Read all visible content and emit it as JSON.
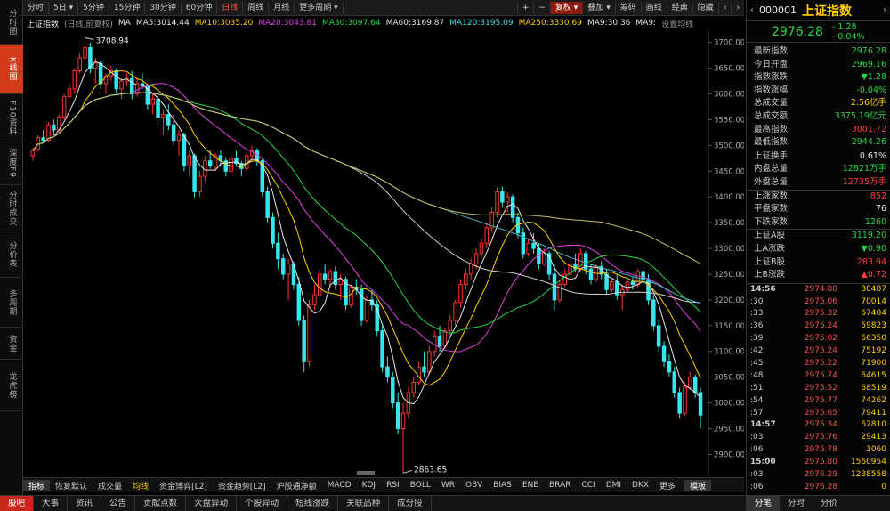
{
  "left_tabs": [
    "分时图",
    "K线图",
    "F10资料",
    "深度F9",
    "分时成交",
    "分价表",
    "多周期",
    "资金",
    "龙虎榜"
  ],
  "period_buttons": [
    "分时",
    "5日",
    "5分钟",
    "15分钟",
    "30分钟",
    "60分钟",
    "日线",
    "周线",
    "月线",
    "更多周期"
  ],
  "toolbar_right": {
    "plus": "+",
    "minus": "−",
    "fuquan": "复权",
    "overlay": "叠加",
    "chip": "筹码",
    "draw": "画线",
    "classic": "经典",
    "hide": "隐藏"
  },
  "ma_bar": {
    "name": "上证指数",
    "mode": "(日线,前复权)",
    "ma": "MA",
    "ma5": "MA5:3014.44",
    "ma10": "MA10:3035.20",
    "ma20": "MA20:3043.81",
    "ma30": "MA30:3097.64",
    "ma60": "MA60:3169.87",
    "ma120": "MA120:3195.09",
    "ma250": "MA250:3330.69",
    "ma9": "MA9:30.36",
    "ma9b": "MA9:",
    "set": "设置均线"
  },
  "chart_data": {
    "type": "candlestick",
    "y_ticks": [
      "3700.00",
      "3650.00",
      "3600.00",
      "3550.00",
      "3500.00",
      "3450.00",
      "3400.00",
      "3350.00",
      "3300.00",
      "3250.00",
      "3200.00",
      "3150.00",
      "3100.00",
      "3050.00",
      "3000.00",
      "2950.00",
      "2900.00"
    ],
    "ylim": [
      2880,
      3715
    ],
    "high_label": "3708.94",
    "low_label": "2863.65",
    "ohlc": [
      [
        3480,
        3495,
        3470,
        3490
      ],
      [
        3492,
        3520,
        3488,
        3515
      ],
      [
        3515,
        3530,
        3505,
        3510
      ],
      [
        3510,
        3545,
        3508,
        3540
      ],
      [
        3540,
        3550,
        3520,
        3530
      ],
      [
        3530,
        3560,
        3525,
        3555
      ],
      [
        3555,
        3600,
        3550,
        3595
      ],
      [
        3595,
        3620,
        3590,
        3610
      ],
      [
        3610,
        3650,
        3600,
        3645
      ],
      [
        3645,
        3680,
        3640,
        3670
      ],
      [
        3670,
        3708.94,
        3660,
        3690
      ],
      [
        3690,
        3700,
        3640,
        3650
      ],
      [
        3650,
        3670,
        3620,
        3660
      ],
      [
        3660,
        3665,
        3610,
        3620
      ],
      [
        3620,
        3640,
        3600,
        3635
      ],
      [
        3635,
        3655,
        3625,
        3645
      ],
      [
        3645,
        3650,
        3600,
        3610
      ],
      [
        3610,
        3630,
        3590,
        3625
      ],
      [
        3625,
        3640,
        3615,
        3630
      ],
      [
        3630,
        3645,
        3590,
        3600
      ],
      [
        3600,
        3630,
        3595,
        3620
      ],
      [
        3620,
        3640,
        3610,
        3615
      ],
      [
        3615,
        3620,
        3570,
        3580
      ],
      [
        3580,
        3600,
        3560,
        3590
      ],
      [
        3590,
        3595,
        3540,
        3555
      ],
      [
        3555,
        3570,
        3520,
        3560
      ],
      [
        3560,
        3580,
        3530,
        3540
      ],
      [
        3540,
        3560,
        3500,
        3510
      ],
      [
        3510,
        3530,
        3480,
        3520
      ],
      [
        3520,
        3525,
        3450,
        3460
      ],
      [
        3460,
        3490,
        3440,
        3480
      ],
      [
        3480,
        3485,
        3400,
        3410
      ],
      [
        3410,
        3450,
        3400,
        3440
      ],
      [
        3440,
        3480,
        3430,
        3470
      ],
      [
        3470,
        3490,
        3455,
        3460
      ],
      [
        3460,
        3485,
        3450,
        3480
      ],
      [
        3480,
        3490,
        3460,
        3470
      ],
      [
        3470,
        3475,
        3440,
        3450
      ],
      [
        3450,
        3480,
        3445,
        3475
      ],
      [
        3475,
        3490,
        3460,
        3465
      ],
      [
        3465,
        3470,
        3440,
        3455
      ],
      [
        3455,
        3485,
        3450,
        3480
      ],
      [
        3480,
        3500,
        3470,
        3490
      ],
      [
        3490,
        3495,
        3460,
        3470
      ],
      [
        3470,
        3475,
        3400,
        3410
      ],
      [
        3410,
        3420,
        3350,
        3360
      ],
      [
        3360,
        3370,
        3300,
        3310
      ],
      [
        3310,
        3330,
        3260,
        3280
      ],
      [
        3280,
        3290,
        3240,
        3250
      ],
      [
        3250,
        3280,
        3200,
        3270
      ],
      [
        3270,
        3275,
        3220,
        3230
      ],
      [
        3230,
        3245,
        3150,
        3160
      ],
      [
        3160,
        3170,
        3060,
        3080
      ],
      [
        3080,
        3200,
        3070,
        3190
      ],
      [
        3190,
        3230,
        3180,
        3210
      ],
      [
        3210,
        3260,
        3205,
        3250
      ],
      [
        3250,
        3270,
        3230,
        3240
      ],
      [
        3240,
        3260,
        3225,
        3255
      ],
      [
        3255,
        3265,
        3220,
        3230
      ],
      [
        3230,
        3250,
        3200,
        3240
      ],
      [
        3240,
        3245,
        3180,
        3190
      ],
      [
        3190,
        3230,
        3185,
        3225
      ],
      [
        3225,
        3240,
        3210,
        3220
      ],
      [
        3220,
        3230,
        3150,
        3160
      ],
      [
        3160,
        3210,
        3155,
        3200
      ],
      [
        3200,
        3220,
        3180,
        3190
      ],
      [
        3190,
        3200,
        3130,
        3140
      ],
      [
        3140,
        3150,
        3060,
        3070
      ],
      [
        3070,
        3090,
        3040,
        3050
      ],
      [
        3050,
        3060,
        2990,
        3000
      ],
      [
        3000,
        3020,
        2940,
        2950
      ],
      [
        2950,
        3000,
        2863.65,
        2980
      ],
      [
        2980,
        3030,
        2970,
        3020
      ],
      [
        3020,
        3050,
        3010,
        3040
      ],
      [
        3040,
        3080,
        3035,
        3070
      ],
      [
        3070,
        3100,
        3050,
        3060
      ],
      [
        3060,
        3110,
        3055,
        3100
      ],
      [
        3100,
        3140,
        3090,
        3130
      ],
      [
        3130,
        3150,
        3100,
        3110
      ],
      [
        3110,
        3145,
        3105,
        3140
      ],
      [
        3140,
        3170,
        3130,
        3160
      ],
      [
        3160,
        3200,
        3150,
        3195
      ],
      [
        3195,
        3240,
        3185,
        3230
      ],
      [
        3230,
        3260,
        3220,
        3250
      ],
      [
        3250,
        3280,
        3240,
        3270
      ],
      [
        3270,
        3300,
        3260,
        3290
      ],
      [
        3290,
        3320,
        3280,
        3310
      ],
      [
        3310,
        3350,
        3300,
        3340
      ],
      [
        3340,
        3380,
        3330,
        3370
      ],
      [
        3370,
        3420,
        3360,
        3410
      ],
      [
        3410,
        3420,
        3380,
        3390
      ],
      [
        3390,
        3410,
        3370,
        3400
      ],
      [
        3400,
        3405,
        3350,
        3360
      ],
      [
        3360,
        3370,
        3320,
        3330
      ],
      [
        3330,
        3340,
        3280,
        3290
      ],
      [
        3290,
        3320,
        3285,
        3310
      ],
      [
        3310,
        3330,
        3290,
        3300
      ],
      [
        3300,
        3310,
        3260,
        3270
      ],
      [
        3270,
        3300,
        3265,
        3290
      ],
      [
        3290,
        3295,
        3240,
        3250
      ],
      [
        3250,
        3270,
        3180,
        3200
      ],
      [
        3200,
        3240,
        3195,
        3230
      ],
      [
        3230,
        3260,
        3225,
        3250
      ],
      [
        3250,
        3280,
        3240,
        3270
      ],
      [
        3270,
        3290,
        3255,
        3260
      ],
      [
        3260,
        3300,
        3255,
        3290
      ],
      [
        3290,
        3295,
        3250,
        3260
      ],
      [
        3260,
        3270,
        3230,
        3240
      ],
      [
        3240,
        3270,
        3235,
        3265
      ],
      [
        3265,
        3275,
        3240,
        3250
      ],
      [
        3250,
        3260,
        3210,
        3220
      ],
      [
        3220,
        3240,
        3215,
        3235
      ],
      [
        3235,
        3250,
        3200,
        3210
      ],
      [
        3210,
        3230,
        3180,
        3220
      ],
      [
        3220,
        3240,
        3215,
        3235
      ],
      [
        3235,
        3245,
        3220,
        3230
      ],
      [
        3230,
        3260,
        3225,
        3255
      ],
      [
        3255,
        3270,
        3230,
        3240
      ],
      [
        3240,
        3250,
        3190,
        3200
      ],
      [
        3200,
        3210,
        3140,
        3150
      ],
      [
        3150,
        3160,
        3100,
        3110
      ],
      [
        3110,
        3120,
        3070,
        3080
      ],
      [
        3080,
        3095,
        3050,
        3060
      ],
      [
        3060,
        3070,
        3010,
        3020
      ],
      [
        3020,
        3030,
        2970,
        2980
      ],
      [
        2980,
        3040,
        2975,
        3030
      ],
      [
        3030,
        3060,
        3025,
        3050
      ],
      [
        3050,
        3055,
        3010,
        3020
      ],
      [
        3020,
        3030,
        2950,
        2976.28
      ]
    ]
  },
  "indicators": [
    "指标",
    "恢复默认",
    "成交量",
    "均线",
    "资金博弈[L2]",
    "资金趋势[L2]",
    "沪股通净额",
    "MACD",
    "KDJ",
    "RSI",
    "BOLL",
    "WR",
    "OBV",
    "BIAS",
    "ENE",
    "BRAR",
    "CCI",
    "DMI",
    "DKX",
    "更多",
    "模板"
  ],
  "bottom_tabs": [
    "股吧",
    "大事",
    "资讯",
    "公告",
    "贡献点数",
    "大盘异动",
    "个股异动",
    "短线涨跌",
    "关联品种",
    "成分股"
  ],
  "right": {
    "code": "000001",
    "name": "上证指数",
    "price": "2976.28",
    "chg": "- 1.28",
    "pct": "- 0.04%",
    "stats1": [
      [
        "最新指数",
        "2976.28"
      ],
      [
        "今日开盘",
        "2969.16"
      ],
      [
        "指数涨跌",
        "▼1.28"
      ],
      [
        "指数涨幅",
        "-0.04%"
      ],
      [
        "总成交量",
        "2.56亿手"
      ],
      [
        "总成交额",
        "3375.19亿元"
      ],
      [
        "最高指数",
        "3001.72"
      ],
      [
        "最低指数",
        "2944.26"
      ]
    ],
    "stats2": [
      [
        "上证换手",
        "0.61%"
      ],
      [
        "内盘总量",
        "12821万手"
      ],
      [
        "外盘总量",
        "12735万手"
      ]
    ],
    "stats3": [
      [
        "上涨家数",
        "852"
      ],
      [
        "平盘家数",
        "76"
      ],
      [
        "下跌家数",
        "1260"
      ]
    ],
    "stats4": [
      [
        "上证A股",
        "3119.20"
      ],
      [
        "上A涨跌",
        "▼0.90"
      ],
      [
        "上证B股",
        "283.94"
      ],
      [
        "上B涨跌",
        "▲0.72"
      ]
    ],
    "ticks": [
      [
        "14:56",
        "2974.80",
        "80487"
      ],
      [
        ":30",
        "2975.06",
        "70014"
      ],
      [
        ":33",
        "2975.32",
        "67404"
      ],
      [
        ":36",
        "2975.24",
        "59823"
      ],
      [
        ":39",
        "2975.02",
        "66350"
      ],
      [
        ":42",
        "2975.24",
        "75192"
      ],
      [
        ":45",
        "2975.22",
        "71900"
      ],
      [
        ":48",
        "2975.74",
        "64615"
      ],
      [
        ":51",
        "2975.52",
        "68519"
      ],
      [
        ":54",
        "2975.77",
        "74262"
      ],
      [
        ":57",
        "2975.65",
        "79411"
      ],
      [
        "14:57",
        "2975.34",
        "62810"
      ],
      [
        ":03",
        "2975.76",
        "29413"
      ],
      [
        ":06",
        "2975.78",
        "1060"
      ],
      [
        "15:00",
        "2975.80",
        "1560954"
      ],
      [
        ":03",
        "2976.29",
        "1238558"
      ],
      [
        ":06",
        "2976.28",
        "0"
      ]
    ],
    "bottom_tabs": [
      "分笔",
      "分时",
      "分价"
    ]
  }
}
